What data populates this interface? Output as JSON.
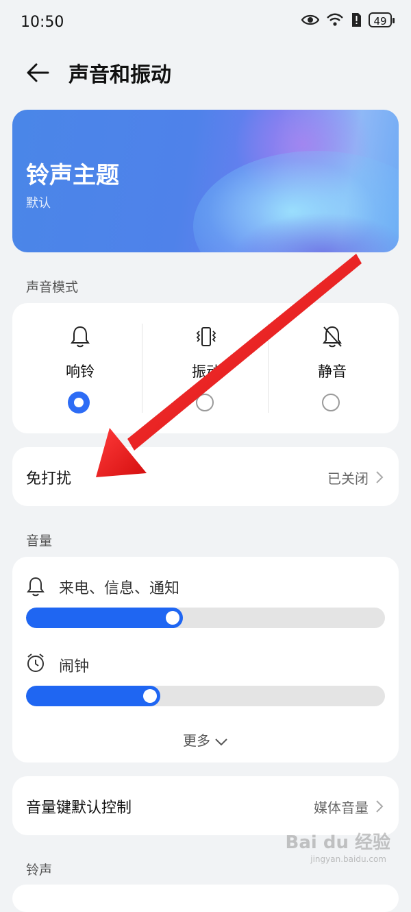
{
  "status_bar": {
    "time": "10:50",
    "battery": "49"
  },
  "header": {
    "title": "声音和振动"
  },
  "banner": {
    "title": "铃声主题",
    "subtitle": "默认"
  },
  "sound_mode": {
    "label": "声音模式",
    "options": [
      {
        "label": "响铃",
        "icon": "bell-icon",
        "selected": true
      },
      {
        "label": "振动",
        "icon": "vibrate-icon",
        "selected": false
      },
      {
        "label": "静音",
        "icon": "bell-off-icon",
        "selected": false
      }
    ]
  },
  "dnd": {
    "title": "免打扰",
    "value": "已关闭"
  },
  "volume": {
    "label": "音量",
    "items": [
      {
        "label": "来电、信息、通知",
        "icon": "bell-icon",
        "level": 0.43
      },
      {
        "label": "闹钟",
        "icon": "alarm-clock-icon",
        "level": 0.37
      }
    ],
    "more": "更多"
  },
  "volume_key": {
    "title": "音量键默认控制",
    "value": "媒体音量"
  },
  "ringtone": {
    "label": "铃声"
  },
  "colors": {
    "accent": "#1f66f2",
    "arrow": "#e31b1b"
  },
  "watermark": {
    "text": "Bai du 经验",
    "sub": "jingyan.baidu.com"
  }
}
